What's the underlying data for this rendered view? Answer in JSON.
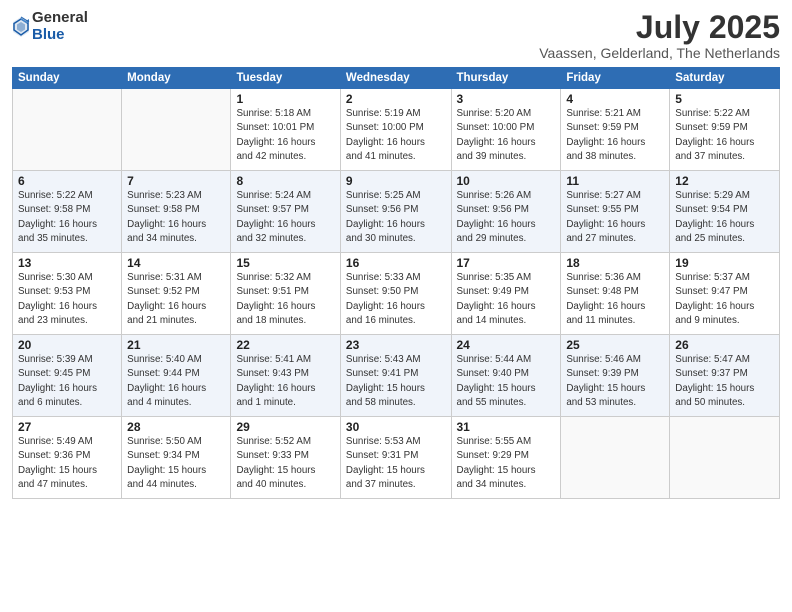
{
  "logo": {
    "general": "General",
    "blue": "Blue"
  },
  "title": "July 2025",
  "subtitle": "Vaassen, Gelderland, The Netherlands",
  "headers": [
    "Sunday",
    "Monday",
    "Tuesday",
    "Wednesday",
    "Thursday",
    "Friday",
    "Saturday"
  ],
  "weeks": [
    [
      {
        "day": "",
        "info": ""
      },
      {
        "day": "",
        "info": ""
      },
      {
        "day": "1",
        "info": "Sunrise: 5:18 AM\nSunset: 10:01 PM\nDaylight: 16 hours\nand 42 minutes."
      },
      {
        "day": "2",
        "info": "Sunrise: 5:19 AM\nSunset: 10:00 PM\nDaylight: 16 hours\nand 41 minutes."
      },
      {
        "day": "3",
        "info": "Sunrise: 5:20 AM\nSunset: 10:00 PM\nDaylight: 16 hours\nand 39 minutes."
      },
      {
        "day": "4",
        "info": "Sunrise: 5:21 AM\nSunset: 9:59 PM\nDaylight: 16 hours\nand 38 minutes."
      },
      {
        "day": "5",
        "info": "Sunrise: 5:22 AM\nSunset: 9:59 PM\nDaylight: 16 hours\nand 37 minutes."
      }
    ],
    [
      {
        "day": "6",
        "info": "Sunrise: 5:22 AM\nSunset: 9:58 PM\nDaylight: 16 hours\nand 35 minutes."
      },
      {
        "day": "7",
        "info": "Sunrise: 5:23 AM\nSunset: 9:58 PM\nDaylight: 16 hours\nand 34 minutes."
      },
      {
        "day": "8",
        "info": "Sunrise: 5:24 AM\nSunset: 9:57 PM\nDaylight: 16 hours\nand 32 minutes."
      },
      {
        "day": "9",
        "info": "Sunrise: 5:25 AM\nSunset: 9:56 PM\nDaylight: 16 hours\nand 30 minutes."
      },
      {
        "day": "10",
        "info": "Sunrise: 5:26 AM\nSunset: 9:56 PM\nDaylight: 16 hours\nand 29 minutes."
      },
      {
        "day": "11",
        "info": "Sunrise: 5:27 AM\nSunset: 9:55 PM\nDaylight: 16 hours\nand 27 minutes."
      },
      {
        "day": "12",
        "info": "Sunrise: 5:29 AM\nSunset: 9:54 PM\nDaylight: 16 hours\nand 25 minutes."
      }
    ],
    [
      {
        "day": "13",
        "info": "Sunrise: 5:30 AM\nSunset: 9:53 PM\nDaylight: 16 hours\nand 23 minutes."
      },
      {
        "day": "14",
        "info": "Sunrise: 5:31 AM\nSunset: 9:52 PM\nDaylight: 16 hours\nand 21 minutes."
      },
      {
        "day": "15",
        "info": "Sunrise: 5:32 AM\nSunset: 9:51 PM\nDaylight: 16 hours\nand 18 minutes."
      },
      {
        "day": "16",
        "info": "Sunrise: 5:33 AM\nSunset: 9:50 PM\nDaylight: 16 hours\nand 16 minutes."
      },
      {
        "day": "17",
        "info": "Sunrise: 5:35 AM\nSunset: 9:49 PM\nDaylight: 16 hours\nand 14 minutes."
      },
      {
        "day": "18",
        "info": "Sunrise: 5:36 AM\nSunset: 9:48 PM\nDaylight: 16 hours\nand 11 minutes."
      },
      {
        "day": "19",
        "info": "Sunrise: 5:37 AM\nSunset: 9:47 PM\nDaylight: 16 hours\nand 9 minutes."
      }
    ],
    [
      {
        "day": "20",
        "info": "Sunrise: 5:39 AM\nSunset: 9:45 PM\nDaylight: 16 hours\nand 6 minutes."
      },
      {
        "day": "21",
        "info": "Sunrise: 5:40 AM\nSunset: 9:44 PM\nDaylight: 16 hours\nand 4 minutes."
      },
      {
        "day": "22",
        "info": "Sunrise: 5:41 AM\nSunset: 9:43 PM\nDaylight: 16 hours\nand 1 minute."
      },
      {
        "day": "23",
        "info": "Sunrise: 5:43 AM\nSunset: 9:41 PM\nDaylight: 15 hours\nand 58 minutes."
      },
      {
        "day": "24",
        "info": "Sunrise: 5:44 AM\nSunset: 9:40 PM\nDaylight: 15 hours\nand 55 minutes."
      },
      {
        "day": "25",
        "info": "Sunrise: 5:46 AM\nSunset: 9:39 PM\nDaylight: 15 hours\nand 53 minutes."
      },
      {
        "day": "26",
        "info": "Sunrise: 5:47 AM\nSunset: 9:37 PM\nDaylight: 15 hours\nand 50 minutes."
      }
    ],
    [
      {
        "day": "27",
        "info": "Sunrise: 5:49 AM\nSunset: 9:36 PM\nDaylight: 15 hours\nand 47 minutes."
      },
      {
        "day": "28",
        "info": "Sunrise: 5:50 AM\nSunset: 9:34 PM\nDaylight: 15 hours\nand 44 minutes."
      },
      {
        "day": "29",
        "info": "Sunrise: 5:52 AM\nSunset: 9:33 PM\nDaylight: 15 hours\nand 40 minutes."
      },
      {
        "day": "30",
        "info": "Sunrise: 5:53 AM\nSunset: 9:31 PM\nDaylight: 15 hours\nand 37 minutes."
      },
      {
        "day": "31",
        "info": "Sunrise: 5:55 AM\nSunset: 9:29 PM\nDaylight: 15 hours\nand 34 minutes."
      },
      {
        "day": "",
        "info": ""
      },
      {
        "day": "",
        "info": ""
      }
    ]
  ]
}
